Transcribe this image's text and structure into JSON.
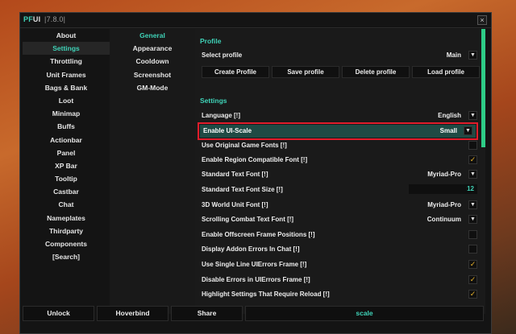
{
  "window": {
    "title_pf": "PF",
    "title_ui": "UI",
    "version": "7.8.0",
    "close_glyph": "×"
  },
  "nav_main": [
    "About",
    "Settings",
    "Throttling",
    "Unit Frames",
    "Bags & Bank",
    "Loot",
    "Minimap",
    "Buffs",
    "Actionbar",
    "Panel",
    "XP Bar",
    "Tooltip",
    "Castbar",
    "Chat",
    "Nameplates",
    "Thirdparty",
    "Components",
    "[Search]"
  ],
  "nav_main_active": "Settings",
  "nav_sub": [
    "General",
    "Appearance",
    "Cooldown",
    "Screenshot",
    "GM-Mode"
  ],
  "nav_sub_active": "General",
  "profile": {
    "section_title": "Profile",
    "select_label": "Select profile",
    "select_value": "Main",
    "buttons": [
      "Create Profile",
      "Save profile",
      "Delete profile",
      "Load profile"
    ]
  },
  "settings": {
    "section_title": "Settings",
    "rows": [
      {
        "label": "Language [!]",
        "type": "dropdown",
        "value": "English"
      },
      {
        "label": "Enable UI-Scale",
        "type": "dropdown",
        "value": "Small",
        "highlighted": true
      },
      {
        "label": "Use Original Game Fonts [!]",
        "type": "checkbox",
        "checked": false
      },
      {
        "label": "Enable Region Compatible Font [!]",
        "type": "checkbox",
        "checked": true
      },
      {
        "label": "Standard Text Font [!]",
        "type": "dropdown",
        "value": "Myriad-Pro"
      },
      {
        "label": "Standard Text Font Size [!]",
        "type": "number",
        "value": "12"
      },
      {
        "label": "3D World Unit Font [!]",
        "type": "dropdown",
        "value": "Myriad-Pro"
      },
      {
        "label": "Scrolling Combat Text Font [!]",
        "type": "dropdown",
        "value": "Continuum"
      },
      {
        "label": "Enable Offscreen Frame Positions [!]",
        "type": "checkbox",
        "checked": false
      },
      {
        "label": "Display Addon Errors In Chat [!]",
        "type": "checkbox",
        "checked": false
      },
      {
        "label": "Use Single Line UIErrors Frame [!]",
        "type": "checkbox",
        "checked": true
      },
      {
        "label": "Disable Errors in UIErrors Frame [!]",
        "type": "checkbox",
        "checked": true
      },
      {
        "label": "Highlight Settings That Require Reload [!]",
        "type": "checkbox",
        "checked": true
      }
    ]
  },
  "bottom": {
    "unlock": "Unlock",
    "hoverbind": "Hoverbind",
    "share": "Share",
    "search_value": "scale"
  },
  "icons": {
    "dropdown": "chevron-down-icon",
    "check": "check-icon"
  },
  "colors": {
    "accent": "#3fd3b8",
    "highlight_border": "#e01d2b",
    "check": "#e8b22a",
    "scrollbar": "#2ecc87"
  }
}
